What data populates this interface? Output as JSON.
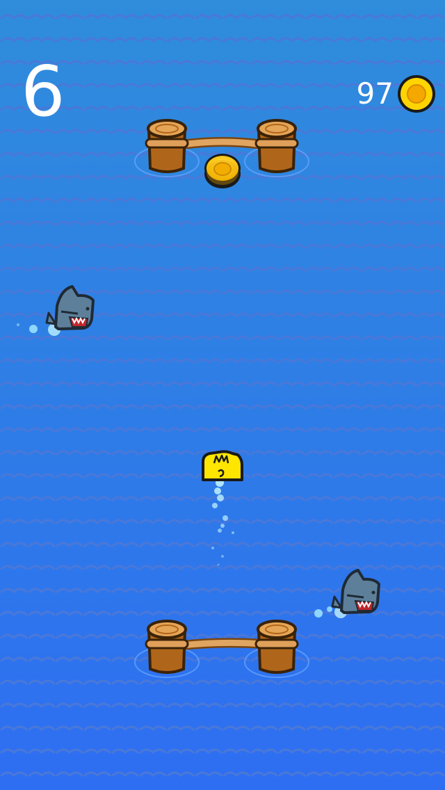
{
  "hud": {
    "score": "6",
    "coins": "97",
    "coin_icon": "gold-coin-icon"
  },
  "colors": {
    "water_top": "#2f8ddb",
    "water_bottom": "#2e6ef2",
    "wave": "#4a78d8",
    "coin_gold": "#ffd400",
    "coin_outline": "#1a1a1a",
    "wood": "#b36b1f",
    "wood_top": "#e8a85a",
    "rope": "#d99a4e",
    "shark": "#5d7f9a",
    "player_duck": "#ffe600"
  },
  "objects": {
    "top_gate": "rope-gate",
    "bottom_gate": "rope-gate",
    "pickup": "gold-coin-icon",
    "sharks": [
      "shark-left",
      "shark-right"
    ],
    "player": "yellow-duck"
  }
}
